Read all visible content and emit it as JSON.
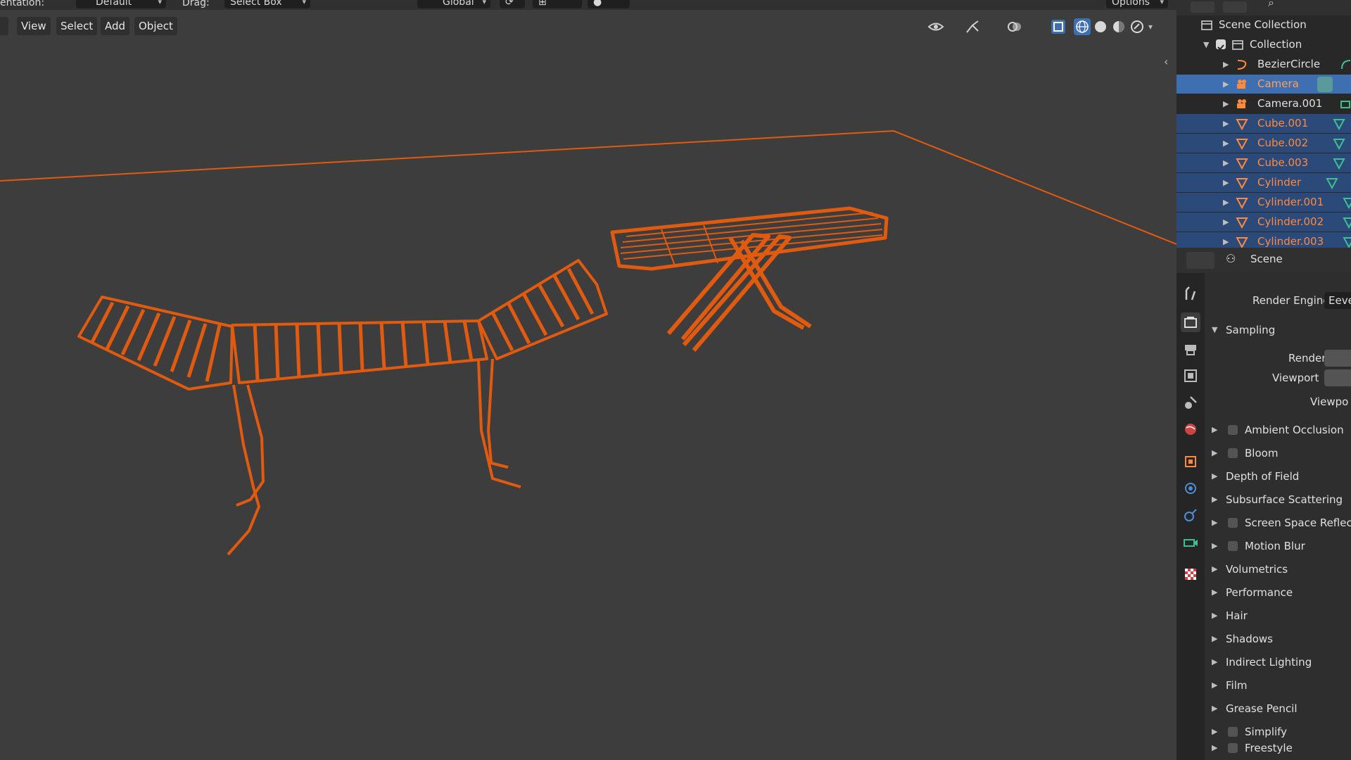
{
  "topbar": {
    "orientation_label": "entation:",
    "orientation_value": "Default",
    "drag_label": "Drag:",
    "drag_value": "Select Box",
    "transform_value": "Global",
    "options_label": "Options"
  },
  "viewport_menu": {
    "view": "View",
    "select": "Select",
    "add": "Add",
    "object": "Object"
  },
  "outliner": {
    "root": "Scene Collection",
    "collection": "Collection",
    "items": [
      {
        "name": "BezierCircle",
        "icon": "curve-icon",
        "state": "normal"
      },
      {
        "name": "Camera",
        "icon": "camera-icon",
        "state": "active"
      },
      {
        "name": "Camera.001",
        "icon": "camera-icon",
        "state": "normal"
      },
      {
        "name": "Cube.001",
        "icon": "mesh-icon",
        "state": "selected"
      },
      {
        "name": "Cube.002",
        "icon": "mesh-icon",
        "state": "selected"
      },
      {
        "name": "Cube.003",
        "icon": "mesh-icon",
        "state": "selected"
      },
      {
        "name": "Cylinder",
        "icon": "mesh-icon",
        "state": "selected"
      },
      {
        "name": "Cylinder.001",
        "icon": "mesh-icon",
        "state": "selected"
      },
      {
        "name": "Cylinder.002",
        "icon": "mesh-icon",
        "state": "selected"
      },
      {
        "name": "Cylinder.003",
        "icon": "mesh-icon",
        "state": "selected"
      }
    ]
  },
  "properties": {
    "context": "Scene",
    "render_engine_label": "Render Engine",
    "render_engine_value": "Eeve",
    "sampling": "Sampling",
    "render_label": "Render",
    "viewport_label": "Viewport",
    "viewport_denoise_label": "Viewpo",
    "panels": [
      {
        "label": "Ambient Occlusion",
        "checkbox": true
      },
      {
        "label": "Bloom",
        "checkbox": true
      },
      {
        "label": "Depth of Field",
        "checkbox": false
      },
      {
        "label": "Subsurface Scattering",
        "checkbox": false
      },
      {
        "label": "Screen Space Reflec",
        "checkbox": true
      },
      {
        "label": "Motion Blur",
        "checkbox": true
      },
      {
        "label": "Volumetrics",
        "checkbox": false
      },
      {
        "label": "Performance",
        "checkbox": false
      },
      {
        "label": "Hair",
        "checkbox": false
      },
      {
        "label": "Shadows",
        "checkbox": false
      },
      {
        "label": "Indirect Lighting",
        "checkbox": false
      },
      {
        "label": "Film",
        "checkbox": false
      },
      {
        "label": "Grease Pencil",
        "checkbox": false
      },
      {
        "label": "Simplify",
        "checkbox": true
      },
      {
        "label": "Freestyle",
        "checkbox": true
      }
    ]
  },
  "colors": {
    "viewport_bg": "#3d3d3d",
    "selection_orange": "#e05a10",
    "outliner_selected": "#2b4a7a",
    "outliner_active": "#3e6fb0",
    "name_orange": "#ff8a3d"
  }
}
